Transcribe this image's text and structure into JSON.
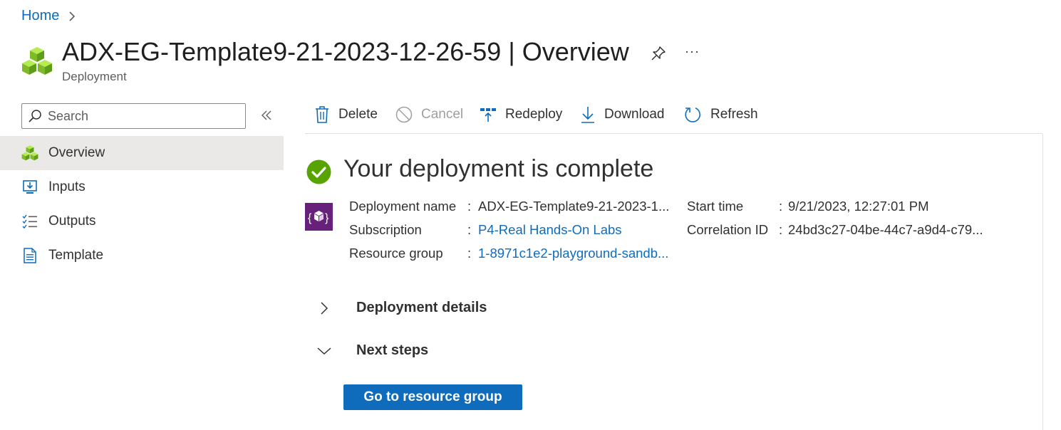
{
  "breadcrumb": {
    "home": "Home"
  },
  "header": {
    "title": "ADX-EG-Template9-21-2023-12-26-59",
    "separator": "|",
    "section": "Overview",
    "subtitle": "Deployment",
    "more": "···"
  },
  "sidebar": {
    "search_placeholder": "Search",
    "items": [
      {
        "label": "Overview",
        "icon": "cubes-icon"
      },
      {
        "label": "Inputs",
        "icon": "inputs-icon"
      },
      {
        "label": "Outputs",
        "icon": "outputs-icon"
      },
      {
        "label": "Template",
        "icon": "document-icon"
      }
    ]
  },
  "toolbar": {
    "delete": "Delete",
    "cancel": "Cancel",
    "redeploy": "Redeploy",
    "download": "Download",
    "refresh": "Refresh"
  },
  "main": {
    "status_title": "Your deployment is complete",
    "details": {
      "deployment_name_label": "Deployment name",
      "deployment_name_value": "ADX-EG-Template9-21-2023-1...",
      "subscription_label": "Subscription",
      "subscription_value": "P4-Real Hands-On Labs",
      "resource_group_label": "Resource group",
      "resource_group_value": "1-8971c1e2-playground-sandb...",
      "start_time_label": "Start time",
      "start_time_value": "9/21/2023, 12:27:01 PM",
      "correlation_id_label": "Correlation ID",
      "correlation_id_value": "24bd3c27-04be-44c7-a9d4-c79...",
      "colon": ":"
    },
    "sections": {
      "deployment_details": "Deployment details",
      "next_steps": "Next steps"
    },
    "go_to_resource_group": "Go to resource group"
  },
  "colors": {
    "accent": "#0f6cbd",
    "success": "#57a300",
    "cube_green": "#8cd03a",
    "deploy_purple": "#68217a",
    "active_nav": "#ebe9e8"
  }
}
